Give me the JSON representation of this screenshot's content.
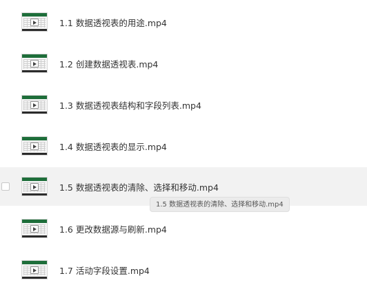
{
  "files": [
    {
      "name": "1.1 数据透视表的用途.mp4",
      "icon": "video-thumbnail-icon",
      "hovered": false
    },
    {
      "name": "1.2 创建数据透视表.mp4",
      "icon": "video-thumbnail-icon",
      "hovered": false
    },
    {
      "name": "1.3 数据透视表结构和字段列表.mp4",
      "icon": "video-thumbnail-icon",
      "hovered": false
    },
    {
      "name": "1.4 数据透视表的显示.mp4",
      "icon": "video-thumbnail-icon",
      "hovered": false
    },
    {
      "name": "1.5 数据透视表的清除、选择和移动.mp4",
      "icon": "video-thumbnail-icon",
      "hovered": true
    },
    {
      "name": "1.6 更改数据源与刷新.mp4",
      "icon": "video-thumbnail-icon",
      "hovered": false
    },
    {
      "name": "1.7 活动字段设置.mp4",
      "icon": "video-thumbnail-icon",
      "hovered": false
    }
  ],
  "tooltip": {
    "text": "1.5 数据透视表的清除、选择和移动.mp4"
  },
  "colors": {
    "hover_background": "#f2f2f2",
    "thumbnail_header": "#1e6e3a",
    "text": "#333333"
  }
}
